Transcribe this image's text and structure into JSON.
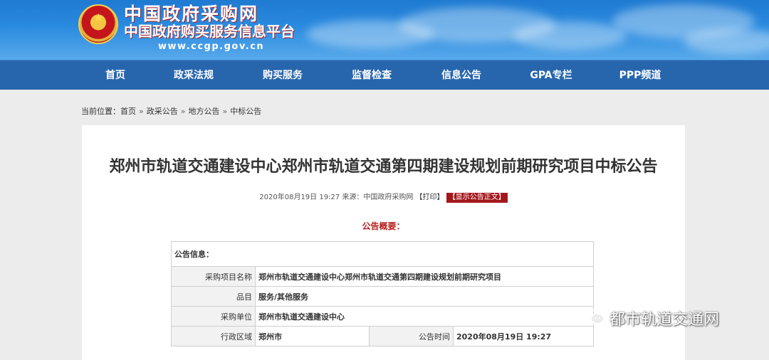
{
  "header": {
    "site_title": "中国政府采购网",
    "site_subtitle": "中国政府购买服务信息平台",
    "site_url": "www.ccgp.gov.cn"
  },
  "nav": {
    "items": [
      "首页",
      "政采法规",
      "购买服务",
      "监督检查",
      "信息公告",
      "GPA专栏",
      "PPP频道"
    ]
  },
  "breadcrumb": {
    "prefix": "当前位置：",
    "items": [
      "首页",
      "政采公告",
      "地方公告",
      "中标公告"
    ],
    "separator": "»"
  },
  "article": {
    "title": "郑州市轨道交通建设中心郑州市轨道交通第四期建设规划前期研究项目中标公告",
    "meta_date": "2020年08月19日 19:27 来源：中国政府采购网",
    "print_label": "【打印】",
    "show_text_label": "【显示公告正文】",
    "summary_heading": "公告概要：",
    "info_heading": "公告信息：",
    "rows": {
      "project_name_label": "采购项目名称",
      "project_name_value": "郑州市轨道交通建设中心郑州市轨道交通第四期建设规划前期研究项目",
      "category_label": "品目",
      "category_value": "服务/其他服务",
      "buyer_label": "采购单位",
      "buyer_value": "郑州市轨道交通建设中心",
      "region_label": "行政区域",
      "region_value": "郑州市",
      "publish_time_label": "公告时间",
      "publish_time_value": "2020年08月19日 19:27"
    }
  },
  "watermark": {
    "text": "都市轨道交通网"
  },
  "colors": {
    "nav_bg": "#2766ad",
    "banner_top": "#1f7ad1",
    "accent_red": "#a3181c",
    "page_bg": "#ececec"
  }
}
